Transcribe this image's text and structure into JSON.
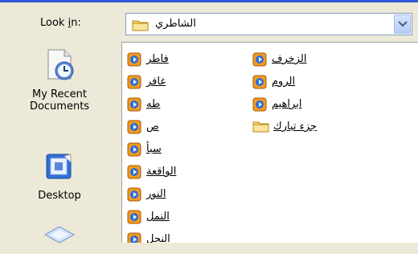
{
  "dialog": {
    "look_in_label_pre": "Look ",
    "look_in_label_u": "i",
    "look_in_label_post": "n:",
    "current_folder": "الشاطري"
  },
  "places": [
    {
      "label_line1": "My Recent",
      "label_line2": "Documents",
      "icon": "recent-documents-icon"
    },
    {
      "label_line1": "Desktop",
      "label_line2": "",
      "icon": "desktop-icon"
    },
    {
      "label_line1": "",
      "label_line2": "",
      "icon": "my-documents-icon"
    }
  ],
  "files": {
    "column1": [
      {
        "name": "فاطر",
        "type": "media"
      },
      {
        "name": "غافر",
        "type": "media"
      },
      {
        "name": "طه",
        "type": "media"
      },
      {
        "name": "ص",
        "type": "media"
      },
      {
        "name": "سبأ",
        "type": "media"
      },
      {
        "name": "الواقعة",
        "type": "media"
      },
      {
        "name": "النور",
        "type": "media"
      },
      {
        "name": "النمل",
        "type": "media"
      },
      {
        "name": "النحل",
        "type": "media"
      }
    ],
    "column2": [
      {
        "name": "الزخرف",
        "type": "media"
      },
      {
        "name": "الروم",
        "type": "media"
      },
      {
        "name": "ابراهيم",
        "type": "media"
      },
      {
        "name": "جزء تبارك",
        "type": "folder"
      }
    ]
  },
  "colors": {
    "dialog_bg": "#ECE9D8",
    "accent": "#2B5BD6",
    "folder": "#F6D66E",
    "media_orange": "#F39A1E",
    "media_blue": "#2A6FD8"
  }
}
